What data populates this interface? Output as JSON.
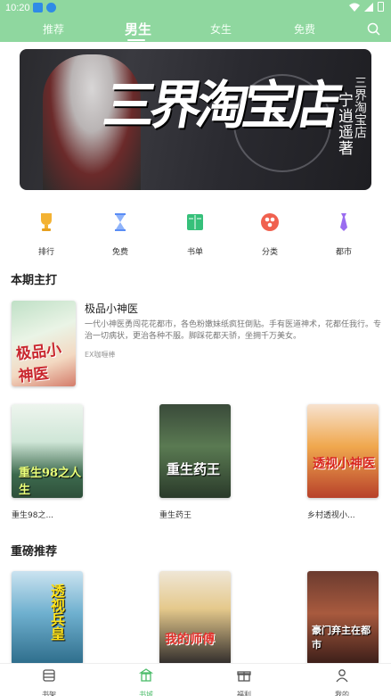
{
  "status_bar": {
    "time": "10:20"
  },
  "top_nav": {
    "tabs": [
      {
        "label": "推荐",
        "active": false
      },
      {
        "label": "男生",
        "active": true
      },
      {
        "label": "女生",
        "active": false
      },
      {
        "label": "免费",
        "active": false
      }
    ],
    "search_icon": "search-icon"
  },
  "banner": {
    "art_title": "三界淘宝店",
    "author": "宁逍遥著",
    "book_title": "三界淘宝店"
  },
  "categories": [
    {
      "label": "排行",
      "icon": "trophy-icon",
      "color": "#f3b233"
    },
    {
      "label": "免费",
      "icon": "hourglass-icon",
      "color": "#5a8df5"
    },
    {
      "label": "书单",
      "icon": "book-icon",
      "color": "#36c07a"
    },
    {
      "label": "分类",
      "icon": "category-icon",
      "color": "#f0614f"
    },
    {
      "label": "都市",
      "icon": "tie-icon",
      "color": "#9a6cf0"
    }
  ],
  "featured": {
    "heading": "本期主打",
    "title": "极品小神医",
    "description": "一代小神医勇闯花花都市，各色粉嫩妹纸疯狂倒贴。手有医道神术，花都任我行。专治一切病状，更治各种不服。脚踩花都天骄，坐拥千万美女。",
    "author": "EX咖喱棒",
    "cover_text": "极品小神医"
  },
  "books_row1": [
    {
      "name": "重生98之...",
      "cover_text": "重生98之人生"
    },
    {
      "name": "重生药王",
      "cover_text": "重生药王"
    },
    {
      "name": "乡村透视小...",
      "cover_text": "透视小神医"
    }
  ],
  "recommend": {
    "heading": "重磅推荐",
    "books": [
      {
        "cover_text": "透视兵皇"
      },
      {
        "cover_text": "我的师傅"
      },
      {
        "cover_text": "豪门弃主在都市"
      }
    ]
  },
  "bottom_nav": [
    {
      "label": "书架",
      "icon": "bookshelf-icon",
      "active": false
    },
    {
      "label": "书城",
      "icon": "bookstore-icon",
      "active": true
    },
    {
      "label": "福利",
      "icon": "gift-icon",
      "active": false
    },
    {
      "label": "我的",
      "icon": "profile-icon",
      "active": false
    }
  ],
  "colors": {
    "accent": "#8fd79f",
    "active_tab": "#4cbc6a"
  }
}
